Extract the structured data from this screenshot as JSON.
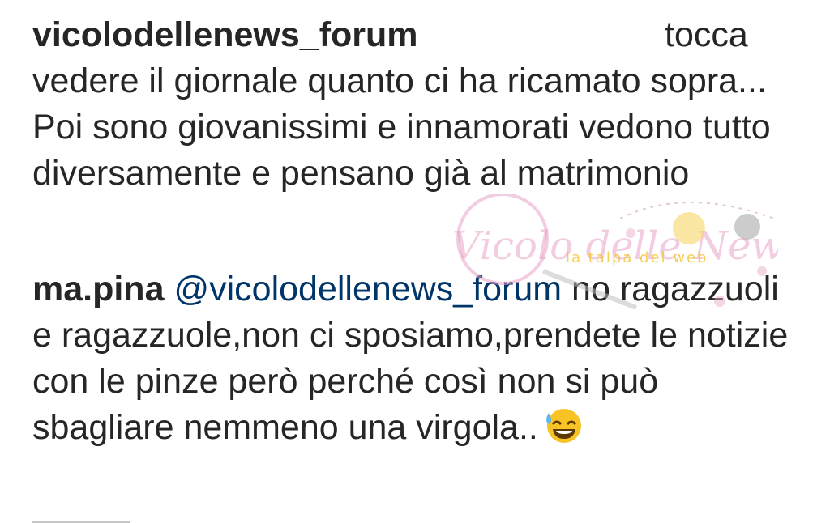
{
  "comments": [
    {
      "username": "vicolodellenews_forum",
      "lead_text": "tocca",
      "text": "vedere il giornale quanto ci ha ricamato sopra... Poi sono giovanissimi e innamorati vedono tutto diversamente e pensano già al matrimonio"
    },
    {
      "username": "ma.pina",
      "mention": "@vicolodellenews_forum",
      "text": " no ragazzuoli e ragazzuole,non ci sposiamo,prendete le notizie con le pinze però perché così non si può sbagliare nemmeno una virgola..",
      "emoji": "sweat-smile-emoji"
    }
  ],
  "watermark": {
    "brand_text": "Vicolo delle News",
    "tagline": "la talpa del web",
    "accent_color": "#e8a3c6",
    "tagline_color": "#f4c430"
  },
  "colors": {
    "text": "#262626",
    "mention": "#003569",
    "background": "#ffffff"
  }
}
